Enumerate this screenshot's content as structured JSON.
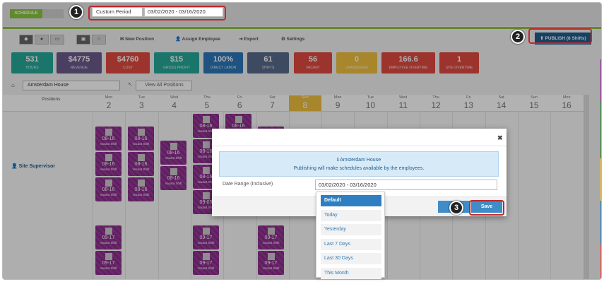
{
  "topbar": {
    "schedule_label": "SCHEDULE",
    "period": "Custom Period",
    "date_range": "03/02/2020 - 03/16/2020"
  },
  "callouts": [
    "1",
    "2",
    "3"
  ],
  "toolbar": {
    "new_position": "New Position",
    "assign_employee": "Assign Employee",
    "export": "Export",
    "settings": "Settings",
    "publish": "PUBLISH (8 Shifts)"
  },
  "kpis": [
    {
      "value": "531",
      "label": "HOURS",
      "color": "#26a99a"
    },
    {
      "value": "$4775",
      "label": "REVENUE",
      "color": "#6a5a8c"
    },
    {
      "value": "$4760",
      "label": "COST",
      "color": "#e0493f"
    },
    {
      "value": "$15",
      "label": "GROSS PROFIT",
      "color": "#26a99a"
    },
    {
      "value": "100%",
      "label": "DIRECT LABOR",
      "color": "#2b76b9"
    },
    {
      "value": "61",
      "label": "SHIFTS",
      "color": "#5a6b8c"
    },
    {
      "value": "56",
      "label": "VACANT",
      "color": "#e0493f"
    },
    {
      "value": "0",
      "label": "UNASSIGNED",
      "color": "#f0c040"
    },
    {
      "value": "166.6",
      "label": "EMPLOYEE OVERTIME",
      "color": "#e0493f"
    },
    {
      "value": "1",
      "label": "SITE OVERTIME",
      "color": "#e0493f"
    }
  ],
  "filter": {
    "location": "Amsterdam House",
    "positions": "View All Positions"
  },
  "grid": {
    "positions_header": "Positions",
    "row_label": "Site Supervisor"
  },
  "days": [
    {
      "name": "Mon",
      "num": "2"
    },
    {
      "name": "Tue",
      "num": "3"
    },
    {
      "name": "Wed",
      "num": "4"
    },
    {
      "name": "Thu",
      "num": "5"
    },
    {
      "name": "Fri",
      "num": "6"
    },
    {
      "name": "Sat",
      "num": "7"
    },
    {
      "name": "Sun",
      "num": "8"
    },
    {
      "name": "Mon",
      "num": "9"
    },
    {
      "name": "Tue",
      "num": "10"
    },
    {
      "name": "Wed",
      "num": "11"
    },
    {
      "name": "Thu",
      "num": "12"
    },
    {
      "name": "Fri",
      "num": "13"
    },
    {
      "name": "Sat",
      "num": "14"
    },
    {
      "name": "Sun",
      "num": "15"
    },
    {
      "name": "Mon",
      "num": "16"
    }
  ],
  "shift_vacant": "Vacant Shift",
  "modal": {
    "location": "Amsterdam House",
    "message": "Publishing will make schedules available by the employees.",
    "date_label": "Date Range (Inclusive)",
    "date_value": "03/02/2020 - 03/16/2020",
    "save": "Save"
  },
  "dropdown": [
    "Default",
    "Today",
    "Yesterday",
    "Last 7 Days",
    "Last 30 Days",
    "This Month"
  ]
}
